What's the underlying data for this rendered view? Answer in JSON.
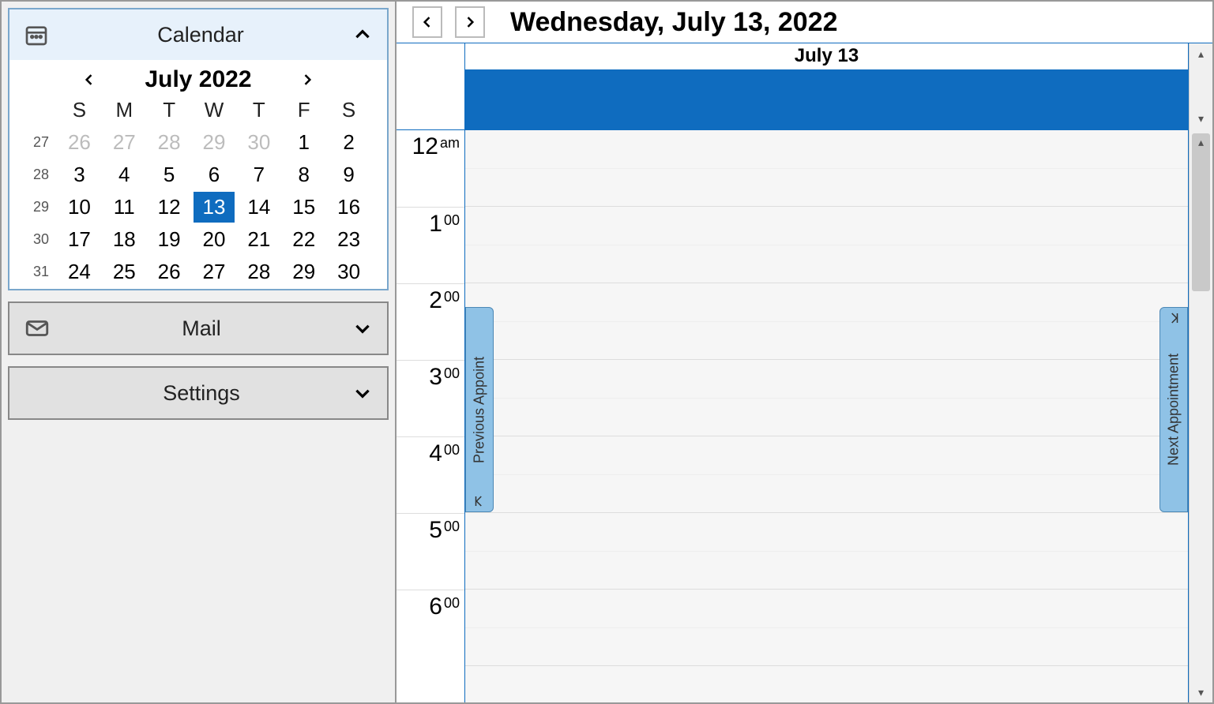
{
  "sidebar": {
    "calendar": {
      "title": "Calendar"
    },
    "mail": {
      "label": "Mail"
    },
    "settings": {
      "label": "Settings"
    },
    "mini": {
      "monthTitle": "July 2022",
      "dow": [
        "S",
        "M",
        "T",
        "W",
        "T",
        "F",
        "S"
      ],
      "rows": [
        {
          "wk": "27",
          "cells": [
            {
              "d": "26",
              "other": true
            },
            {
              "d": "27",
              "other": true
            },
            {
              "d": "28",
              "other": true
            },
            {
              "d": "29",
              "other": true
            },
            {
              "d": "30",
              "other": true
            },
            {
              "d": "1"
            },
            {
              "d": "2"
            }
          ]
        },
        {
          "wk": "28",
          "cells": [
            {
              "d": "3"
            },
            {
              "d": "4"
            },
            {
              "d": "5"
            },
            {
              "d": "6"
            },
            {
              "d": "7"
            },
            {
              "d": "8"
            },
            {
              "d": "9"
            }
          ]
        },
        {
          "wk": "29",
          "cells": [
            {
              "d": "10"
            },
            {
              "d": "11"
            },
            {
              "d": "12"
            },
            {
              "d": "13",
              "sel": true
            },
            {
              "d": "14"
            },
            {
              "d": "15"
            },
            {
              "d": "16"
            }
          ]
        },
        {
          "wk": "30",
          "cells": [
            {
              "d": "17"
            },
            {
              "d": "18"
            },
            {
              "d": "19"
            },
            {
              "d": "20"
            },
            {
              "d": "21"
            },
            {
              "d": "22"
            },
            {
              "d": "23"
            }
          ]
        },
        {
          "wk": "31",
          "cells": [
            {
              "d": "24"
            },
            {
              "d": "25"
            },
            {
              "d": "26"
            },
            {
              "d": "27"
            },
            {
              "d": "28"
            },
            {
              "d": "29"
            },
            {
              "d": "30"
            }
          ]
        }
      ]
    }
  },
  "main": {
    "dateTitle": "Wednesday, July 13, 2022",
    "dayHeader": "July 13",
    "prevApptLabel": "Previous Appoint",
    "nextApptLabel": "Next Appointment",
    "hours": [
      {
        "hr": "12",
        "mn": "am"
      },
      {
        "hr": "1",
        "mn": "00"
      },
      {
        "hr": "2",
        "mn": "00"
      },
      {
        "hr": "3",
        "mn": "00"
      },
      {
        "hr": "4",
        "mn": "00"
      },
      {
        "hr": "5",
        "mn": "00"
      },
      {
        "hr": "6",
        "mn": "00"
      }
    ]
  }
}
